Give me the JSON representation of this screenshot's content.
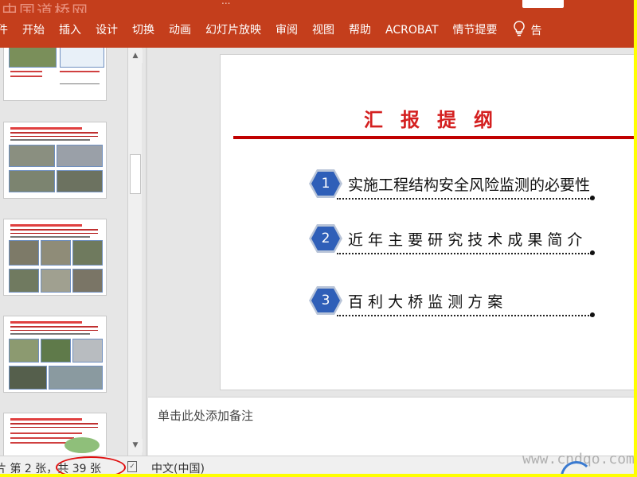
{
  "window": {
    "watermark_top": "中国道桥网",
    "title_fragment": "...",
    "watermark_bottom": "www.cndqo.com"
  },
  "ribbon": {
    "tabs": [
      "件",
      "开始",
      "插入",
      "设计",
      "切换",
      "动画",
      "幻灯片放映",
      "审阅",
      "视图",
      "帮助",
      "ACROBAT",
      "情节提要"
    ],
    "tell_me_icon": "lightbulb-icon",
    "tell_me_label": "告"
  },
  "slide": {
    "title": "汇报提纲",
    "items": [
      {
        "number": "1",
        "text": "实施工程结构安全风险监测的必要性"
      },
      {
        "number": "2",
        "text": "近 年 主 要 研 究 技 术 成 果 简 介"
      },
      {
        "number": "3",
        "text": "百   利   大   桥   监   测   方   案"
      }
    ],
    "accent_color": "#c00000",
    "hex_color": "#2f5fb8"
  },
  "notes": {
    "placeholder": "单击此处添加备注"
  },
  "status": {
    "slide_info": "片 第 2 张，共 39 张",
    "spell_icon": "spellcheck-icon",
    "language": "中文(中国)"
  }
}
